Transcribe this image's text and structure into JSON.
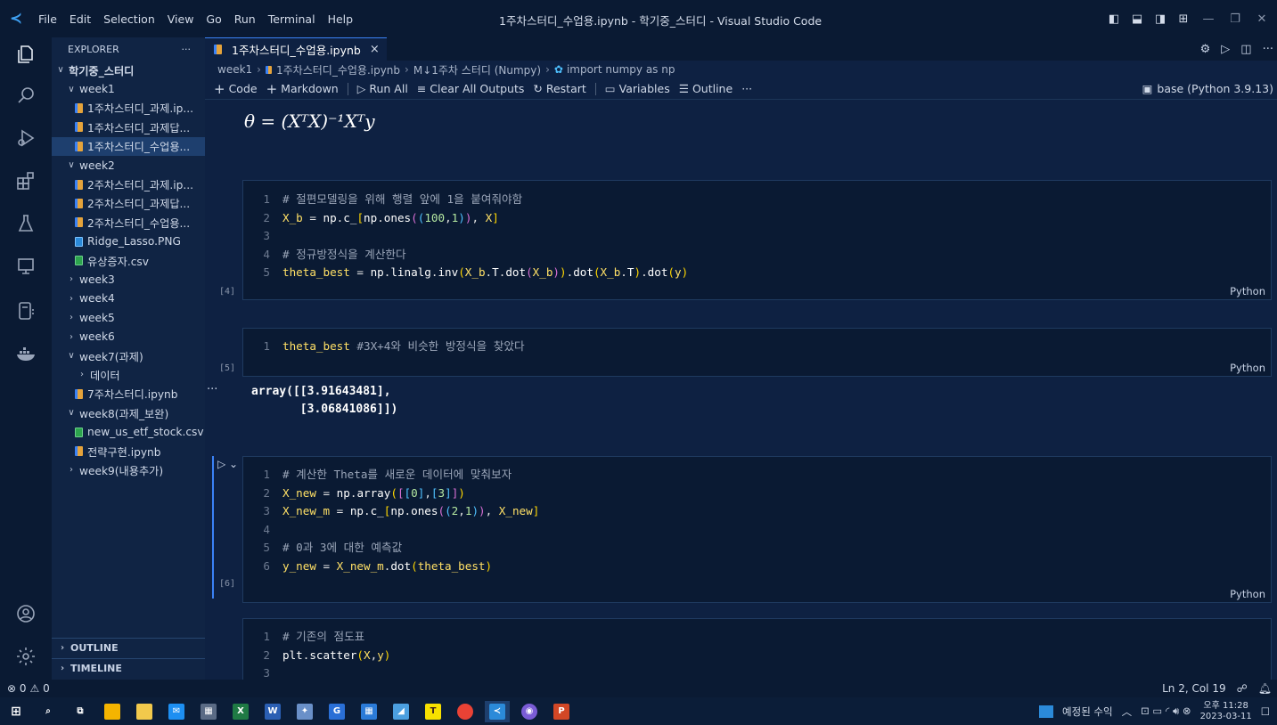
{
  "window": {
    "title": "1주차스터디_수업용.ipynb - 학기중_스터디 - Visual Studio Code",
    "menu": [
      "File",
      "Edit",
      "Selection",
      "View",
      "Go",
      "Run",
      "Terminal",
      "Help"
    ]
  },
  "sidebar": {
    "header": "EXPLORER",
    "more": "···",
    "root": "학기중_스터디",
    "items": [
      {
        "label": "week1",
        "kind": "folder-open",
        "depth": 1
      },
      {
        "label": "1주차스터디_과제.ip...",
        "kind": "notebook",
        "depth": 2
      },
      {
        "label": "1주차스터디_과제답...",
        "kind": "notebook",
        "depth": 2
      },
      {
        "label": "1주차스터디_수업용...",
        "kind": "notebook",
        "depth": 2,
        "selected": true
      },
      {
        "label": "week2",
        "kind": "folder-open",
        "depth": 1
      },
      {
        "label": "2주차스터디_과제.ip...",
        "kind": "notebook",
        "depth": 2
      },
      {
        "label": "2주차스터디_과제답...",
        "kind": "notebook",
        "depth": 2
      },
      {
        "label": "2주차스터디_수업용...",
        "kind": "notebook",
        "depth": 2
      },
      {
        "label": "Ridge_Lasso.PNG",
        "kind": "png",
        "depth": 2
      },
      {
        "label": "유상증자.csv",
        "kind": "csv",
        "depth": 2
      },
      {
        "label": "week3",
        "kind": "folder-closed",
        "depth": 1
      },
      {
        "label": "week4",
        "kind": "folder-closed",
        "depth": 1
      },
      {
        "label": "week5",
        "kind": "folder-closed",
        "depth": 1
      },
      {
        "label": "week6",
        "kind": "folder-closed",
        "depth": 1
      },
      {
        "label": "week7(과제)",
        "kind": "folder-open",
        "depth": 1
      },
      {
        "label": "데이터",
        "kind": "folder-closed",
        "depth": 2
      },
      {
        "label": "7주차스터디.ipynb",
        "kind": "notebook",
        "depth": 2
      },
      {
        "label": "week8(과제_보완)",
        "kind": "folder-open",
        "depth": 1
      },
      {
        "label": "new_us_etf_stock.csv",
        "kind": "csv",
        "depth": 2
      },
      {
        "label": "전략구현.ipynb",
        "kind": "notebook",
        "depth": 2
      },
      {
        "label": "week9(내용추가)",
        "kind": "folder-closed",
        "depth": 1
      }
    ],
    "outline": "OUTLINE",
    "timeline": "TIMELINE"
  },
  "editor": {
    "tab": {
      "label": "1주차스터디_수업용.ipynb",
      "close": "×"
    },
    "breadcrumb": [
      "week1",
      "1주차스터디_수업용.ipynb",
      "M↓1주차 스터디 (Numpy)",
      "import numpy as np"
    ],
    "toolbar": {
      "code": "Code",
      "markdown": "Markdown",
      "run_all": "Run All",
      "clear": "Clear All Outputs",
      "restart": "Restart",
      "variables": "Variables",
      "outline": "Outline",
      "more": "···",
      "kernel": "base (Python 3.9.13)"
    },
    "formula": "θ = (XᵀX)⁻¹Xᵀy",
    "cells": [
      {
        "exec": "[4]",
        "lang": "Python",
        "lines": [
          "# 절편모델링을 위해 행렬 앞에 1을 붙여줘야함",
          "X_b = np.c_[np.ones((100,1)), X]",
          "",
          "# 정규방정식을 계산한다",
          "theta_best = np.linalg.inv(X_b.T.dot(X_b)).dot(X_b.T).dot(y)"
        ]
      },
      {
        "exec": "[5]",
        "lang": "Python",
        "lines": [
          "theta_best #3X+4와 비슷한 방정식을 찾았다"
        ],
        "output": "array([[3.91643481],\n       [3.06841086]])"
      },
      {
        "exec": "[6]",
        "lang": "Python",
        "lines": [
          "# 계산한 Theta를 새로운 데이터에 맞춰보자",
          "X_new = np.array([[0],[3]])",
          "X_new_m = np.c_[np.ones((2,1)), X_new]",
          "",
          "# 0과 3에 대한 예측값",
          "y_new = X_new_m.dot(theta_best)"
        ]
      },
      {
        "exec": "",
        "lang": "",
        "lines": [
          "# 기존의 점도표",
          "plt.scatter(X,y)",
          ""
        ]
      }
    ]
  },
  "status": {
    "errors": "⊗ 0",
    "warnings": "⚠ 0",
    "position": "Ln 2, Col 19"
  },
  "taskbar": {
    "notification": "예정된 수익",
    "clock_time": "오후 11:28",
    "clock_date": "2023-03-11"
  }
}
